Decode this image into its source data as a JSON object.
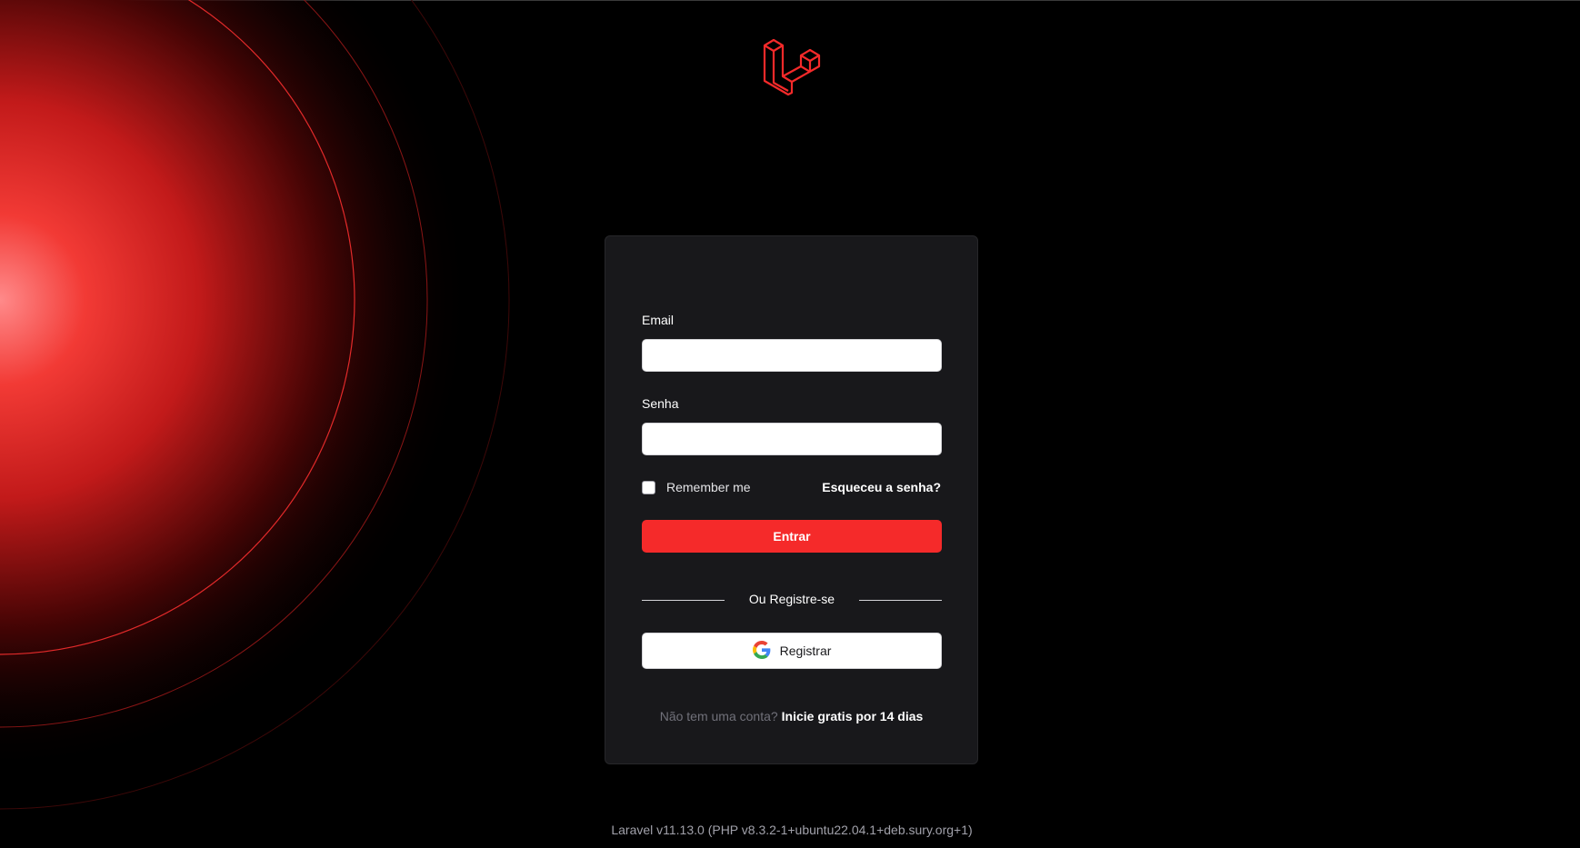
{
  "form": {
    "email_label": "Email",
    "email_value": "",
    "password_label": "Senha",
    "password_value": "",
    "remember_label": "Remember me",
    "remember_checked": false,
    "forgot_label": "Esqueceu a senha?",
    "submit_label": "Entrar"
  },
  "social": {
    "divider_text": "Ou Registre-se",
    "google_label": "Registrar"
  },
  "signup": {
    "prompt": "Não tem uma conta?",
    "link_label": "Inicie gratis por 14 dias"
  },
  "footer": {
    "version_text": "Laravel v11.13.0 (PHP v8.3.2-1+ubuntu22.04.1+deb.sury.org+1)"
  },
  "colors": {
    "accent": "#f52a2a",
    "background": "#000000",
    "card": "#18181b"
  },
  "icons": {
    "logo": "laravel-logo-icon",
    "google": "google-icon"
  }
}
